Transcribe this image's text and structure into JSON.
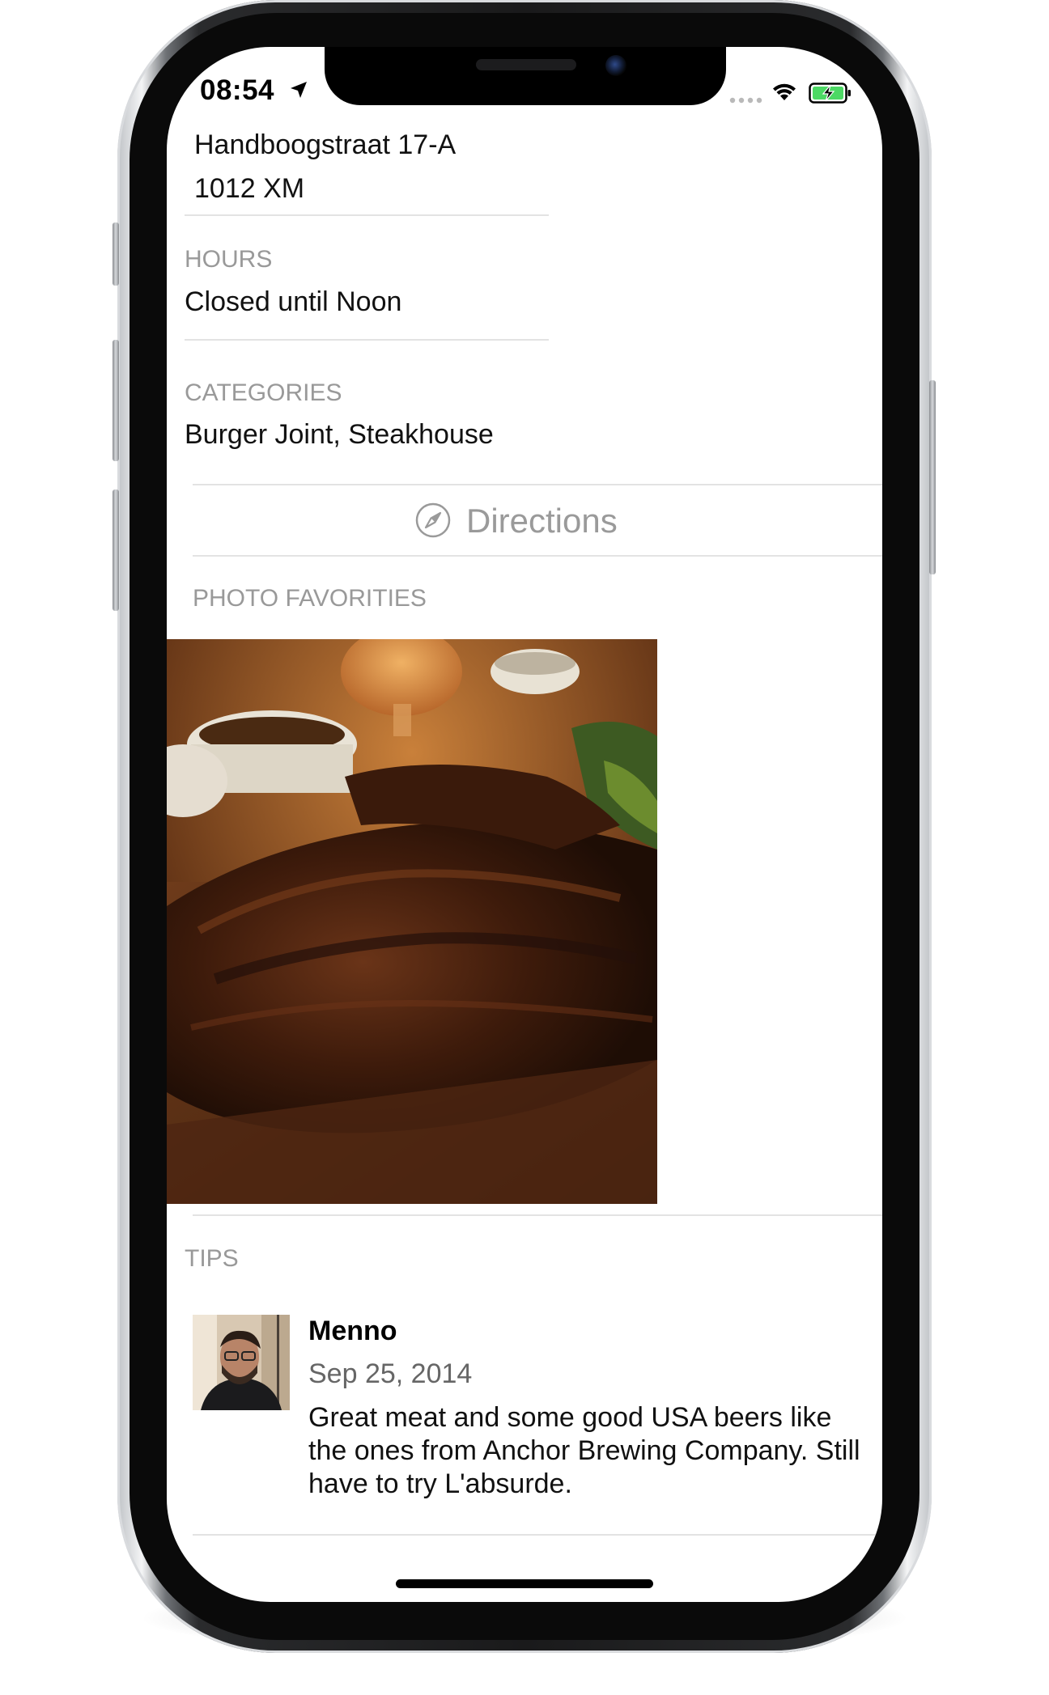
{
  "status_bar": {
    "time": "08:54"
  },
  "address": {
    "street": "Handboogstraat 17-A",
    "postal_code": "1012 XM"
  },
  "hours": {
    "label": "HOURS",
    "value": "Closed until Noon"
  },
  "categories": {
    "label": "CATEGORIES",
    "value": "Burger Joint, Steakhouse"
  },
  "directions": {
    "label": "Directions",
    "icon": "compass-icon"
  },
  "photo_favorites": {
    "label": "PHOTO FAVORITIES"
  },
  "tips": {
    "label": "TIPS",
    "items": [
      {
        "name": "Menno",
        "date": "Sep 25, 2014",
        "text": "Great meat and some good USA beers like the ones from Anchor Brewing Company. Still have to try L'absurde."
      }
    ]
  },
  "colors": {
    "label_gray": "#999999",
    "separator": "#e3e3e3",
    "battery_green": "#4cd964"
  }
}
